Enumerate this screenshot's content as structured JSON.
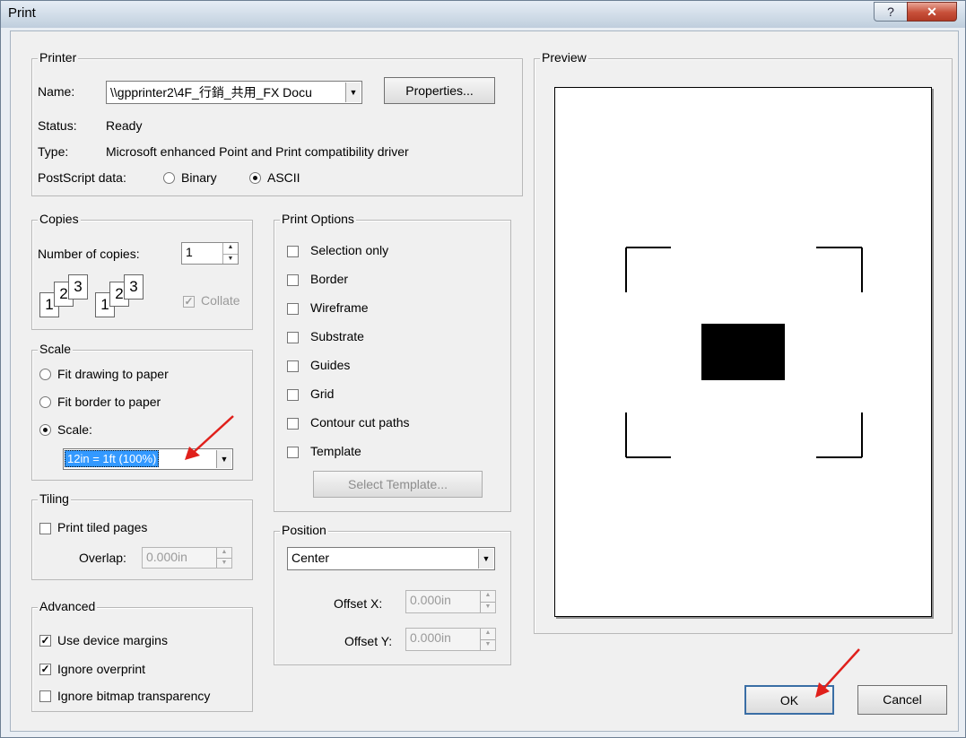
{
  "window": {
    "title": "Print",
    "help_label": "?",
    "close_label": "✕"
  },
  "printer": {
    "legend": "Printer",
    "name_label": "Name:",
    "name_value": "\\\\gpprinter2\\4F_行銷_共用_FX Docu",
    "properties_label": "Properties...",
    "status_label": "Status:",
    "status_value": "Ready",
    "type_label": "Type:",
    "type_value": "Microsoft enhanced Point and Print compatibility driver",
    "postscript_label": "PostScript data:",
    "binary_label": "Binary",
    "ascii_label": "ASCII",
    "postscript_selected": "ASCII"
  },
  "copies": {
    "legend": "Copies",
    "number_label": "Number of copies:",
    "number_value": "1",
    "collate_label": "Collate",
    "collate_checked": true,
    "collate_enabled": false,
    "page_numbers": [
      "1",
      "2",
      "3"
    ]
  },
  "scale": {
    "legend": "Scale",
    "options": [
      "Fit drawing to paper",
      "Fit border to paper",
      "Scale:"
    ],
    "selected": "Scale:",
    "scale_value": "12in = 1ft (100%)"
  },
  "tiling": {
    "legend": "Tiling",
    "print_tiled_label": "Print tiled pages",
    "overlap_label": "Overlap:",
    "overlap_value": "0.000in"
  },
  "advanced": {
    "legend": "Advanced",
    "items": [
      {
        "label": "Use device margins",
        "checked": true
      },
      {
        "label": "Ignore overprint",
        "checked": true
      },
      {
        "label": "Ignore bitmap transparency",
        "checked": false
      }
    ]
  },
  "print_options": {
    "legend": "Print Options",
    "items": [
      "Selection only",
      "Border",
      "Wireframe",
      "Substrate",
      "Guides",
      "Grid",
      "Contour cut paths",
      "Template"
    ],
    "select_template_label": "Select Template..."
  },
  "position": {
    "legend": "Position",
    "value": "Center",
    "offset_x_label": "Offset X:",
    "offset_x_value": "0.000in",
    "offset_y_label": "Offset Y:",
    "offset_y_value": "0.000in"
  },
  "preview": {
    "legend": "Preview"
  },
  "buttons": {
    "ok_label": "OK",
    "cancel_label": "Cancel"
  },
  "colors": {
    "annotation_arrow": "#e0201b",
    "selection_highlight": "#3399ff",
    "title_gradient_top": "#e6edf5",
    "close_button": "#c7503a"
  }
}
